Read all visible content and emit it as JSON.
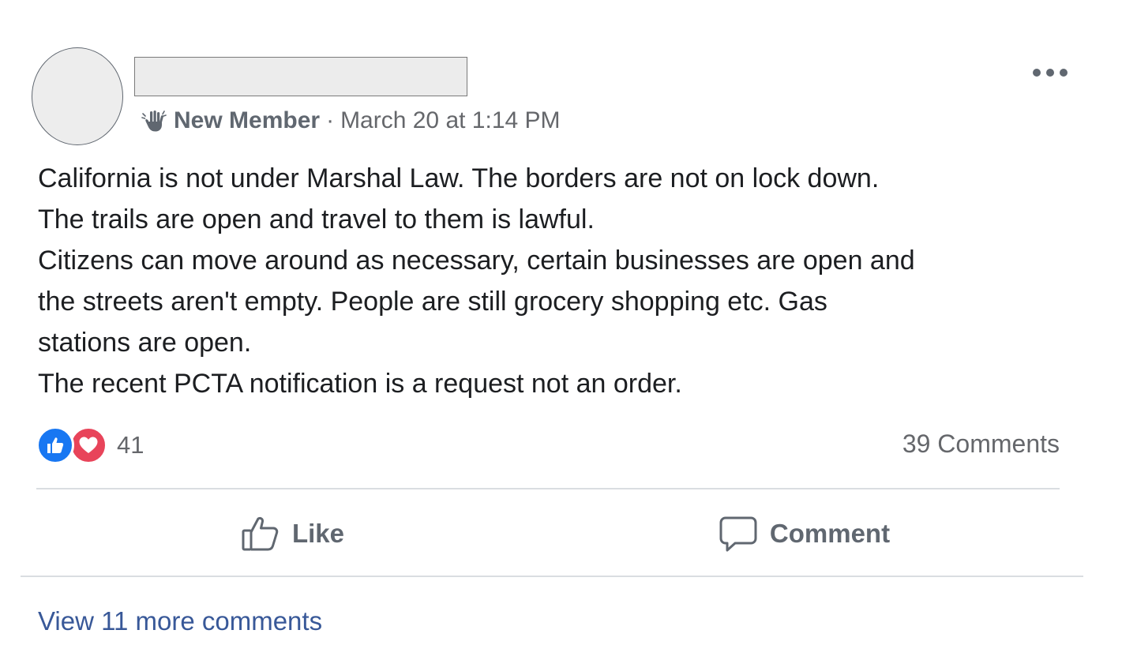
{
  "post": {
    "author_badge": "New Member",
    "separator": "·",
    "timestamp": "March 20 at 1:14 PM",
    "more_icon": "more-horizontal-icon",
    "body_lines": [
      "California is not under Marshal Law. The borders are not on lock down.",
      "The trails are open and travel to them is lawful.",
      "Citizens can move around as necessary, certain businesses are open and",
      "the streets aren't empty. People are still grocery shopping etc. Gas",
      "stations are open.",
      "The recent PCTA notification is a request not an order."
    ]
  },
  "reactions": {
    "icons": [
      "like-reaction-icon",
      "love-reaction-icon"
    ],
    "count": "41"
  },
  "comments_summary": "39 Comments",
  "actions": {
    "like_label": "Like",
    "comment_label": "Comment"
  },
  "view_more": "View 11 more comments",
  "colors": {
    "like_blue": "#1877f2",
    "love_red": "#e8445a",
    "link_blue": "#385898",
    "secondary_text": "#65676b"
  }
}
